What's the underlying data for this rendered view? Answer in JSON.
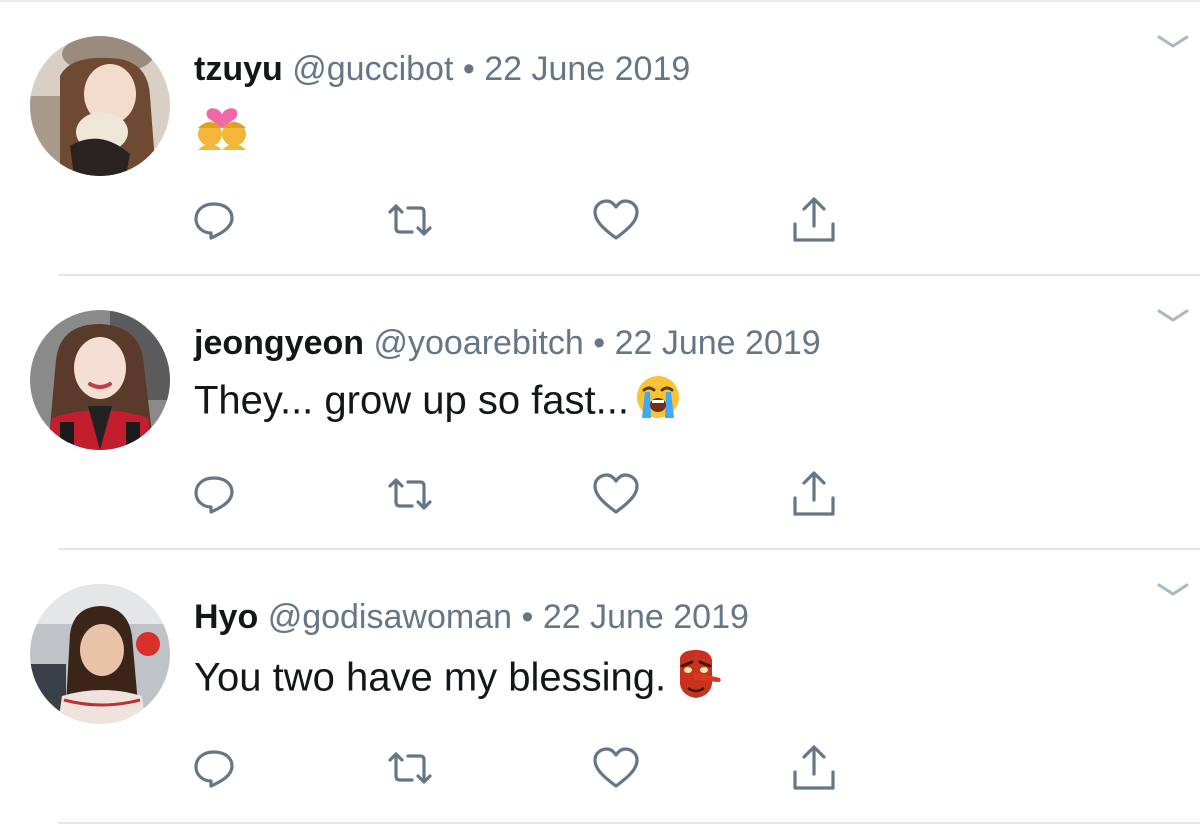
{
  "tweets": [
    {
      "name": "tzuyu",
      "handle": "@guccibot",
      "separator": "•",
      "date": "22 June 2019",
      "text": "",
      "emoji": "kiss-heart-emoji",
      "avatar": "avatar-tzuyu"
    },
    {
      "name": "jeongyeon",
      "handle": "@yooarebitch",
      "separator": "•",
      "date": "22 June 2019",
      "text": "They... grow up so fast...",
      "emoji": "loudly-crying-face-emoji",
      "avatar": "avatar-jeongyeon"
    },
    {
      "name": "Hyo",
      "handle": "@godisawoman",
      "separator": "•",
      "date": "22 June 2019",
      "text": "You two have my blessing.",
      "emoji": "tengu-mask-emoji",
      "avatar": "avatar-hyo"
    }
  ],
  "icons": {
    "reply": "reply-icon",
    "retweet": "retweet-icon",
    "like": "heart-icon",
    "share": "share-icon",
    "more": "chevron-down-icon"
  },
  "colors": {
    "icon": "#657786",
    "divider": "#e1e8ed",
    "name": "#14171a",
    "meta": "#657786"
  }
}
